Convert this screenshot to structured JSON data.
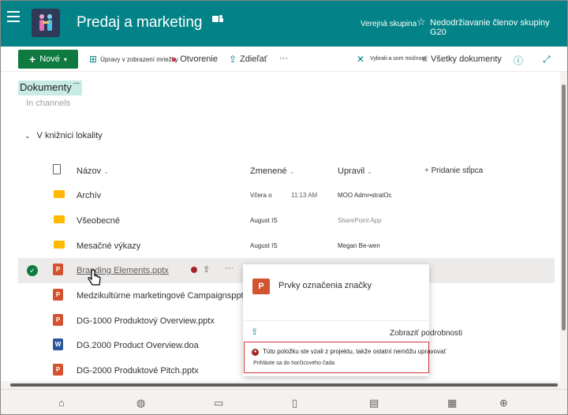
{
  "header": {
    "site_title": "Predaj a marketing",
    "group_type": "Verejná skupina",
    "follow_label": "Nedodržiavanie členov skupiny G20",
    "teams_icon": "teams-icon",
    "menu_icon": "hamburger-icon"
  },
  "commandbar": {
    "new_label": "Nové",
    "edit_grid_label": "Úpravy v zobrazení mriežky",
    "open_label": "Otvorenie",
    "share_label": "Zdieľať",
    "more_label": "···",
    "selected_label": "Vybrali-a som možnosť",
    "view_label": "Všetky dokumenty"
  },
  "library": {
    "title": "Dokumenty",
    "title_sup": "~~",
    "ghost_section": "In channels",
    "section_label": "V knižnici lokality"
  },
  "columns": {
    "name": "Názov",
    "modified": "Zmenené",
    "modified_by": "Upravil",
    "add_column": "Pridanie stĺpca"
  },
  "rows": [
    {
      "type": "folder",
      "name": "Archív",
      "modified": "Včera o",
      "time": "11:13 AM",
      "by": "MOO Admr•stratOc"
    },
    {
      "type": "folder",
      "name": "Všeobecné",
      "modified": "August IS",
      "time": "",
      "by": "SharePoint App"
    },
    {
      "type": "folder",
      "name": "Mesačné výkazy",
      "modified": "August IS",
      "time": "",
      "by": "Megan Be-wen"
    },
    {
      "type": "ppt",
      "name": "Branding Elements.pptx",
      "modified": "",
      "time": "",
      "by": ""
    },
    {
      "type": "ppt",
      "name": "Medzikultúrne marketingové Campaignspptx",
      "modified": "",
      "time": "",
      "by": ""
    },
    {
      "type": "ppt",
      "name": "DG-1000 Produktový Overview.pptx",
      "modified": "",
      "time": "",
      "by": ""
    },
    {
      "type": "word",
      "name": "DG.2000 Product Overview.doa",
      "modified": "",
      "time": "",
      "by": ""
    },
    {
      "type": "ppt",
      "name": "DG-2000 Produktové Pitch.pptx",
      "modified": "",
      "time": "",
      "by": ""
    }
  ],
  "hovercard": {
    "title": "Prvky označenia značky",
    "details_label": "Zobraziť podrobnosti",
    "warning_text": "Túto položku ste vzali z projektu, takže ostatní nemôžu upravovať",
    "warning_link": "Prihláste sa do horčicového čada"
  },
  "colors": {
    "header_bg": "#038387",
    "new_button_bg": "#0f7a3f",
    "warning_border": "#d13438"
  }
}
